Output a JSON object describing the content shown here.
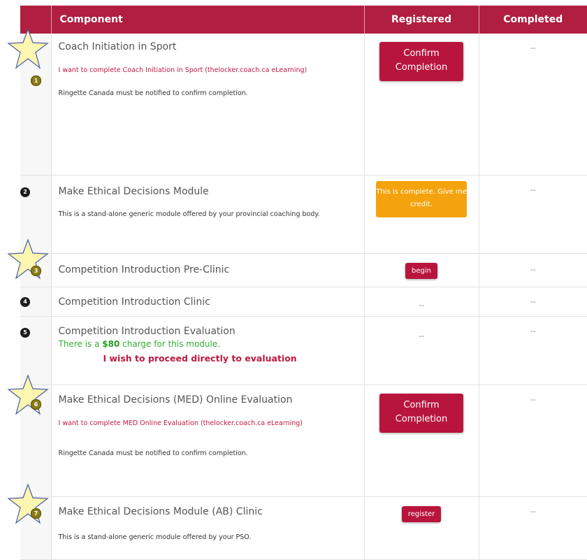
{
  "header": {
    "component": "Component",
    "registered": "Registered",
    "completed": "Completed"
  },
  "rows": [
    {
      "number": "1",
      "title": "Coach Initiation in Sport",
      "link_text": "I want to complete Coach Initiation in Sport (thelocker.coach.ca eLearning)",
      "note": "Ringette Canada must be notified to confirm completion.",
      "registered_action": "Confirm Completion",
      "completed": "--",
      "starred": true
    },
    {
      "number": "2",
      "title": "Make Ethical Decisions Module",
      "note": "This is a stand-alone generic module offered by your provincial coaching body.",
      "registered_action": "This is complete. Give me credit.",
      "completed": "--",
      "starred": false
    },
    {
      "number": "3",
      "title": "Competition Introduction Pre-Clinic",
      "registered_action": "begin",
      "completed": "--",
      "starred": true
    },
    {
      "number": "4",
      "title": "Competition Introduction Clinic",
      "registered": "--",
      "completed": "--",
      "starred": false
    },
    {
      "number": "5",
      "title": "Competition Introduction Evaluation",
      "charge_prefix": "There is a ",
      "charge_amount": "$80",
      "charge_suffix": " charge for this module.",
      "proceed_text": "I wish to proceed directly to evaluation",
      "registered": "--",
      "completed": "--",
      "starred": false
    },
    {
      "number": "6",
      "title": "Make Ethical Decisions (MED) Online Evaluation",
      "link_text": "I want to complete MED Online Evaluation (thelocker.coach.ca eLearning)",
      "note": "Ringette Canada must be notified to confirm completion.",
      "registered_action": "Confirm Completion",
      "completed": "--",
      "starred": true
    },
    {
      "number": "7",
      "title": "Make Ethical Decisions Module (AB) Clinic",
      "note": "This is a stand-alone generic module offered by your PSO.",
      "registered_action": "register",
      "completed": "--",
      "starred": true
    }
  ],
  "colors": {
    "header_bg": "#b01e40",
    "button_red": "#b8153d",
    "button_orange": "#f4a30e",
    "link_red": "#c0193f",
    "charge_green": "#33b033",
    "star_fill": "#fbf6b0",
    "star_stroke": "#4a5da8"
  }
}
